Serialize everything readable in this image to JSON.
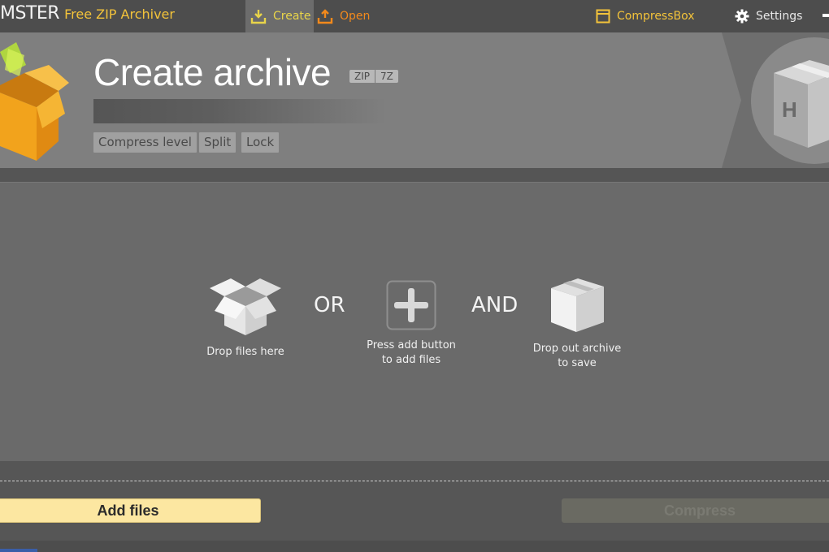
{
  "app": {
    "brand_name": "MSTER",
    "product_name": "Free ZIP Archiver"
  },
  "nav": {
    "create_label": "Create",
    "open_label": "Open",
    "compressbox_label": "CompressBox",
    "settings_label": "Settings"
  },
  "header": {
    "title": "Create archive",
    "formats": [
      "ZIP",
      "7Z"
    ],
    "options": {
      "compress_level": "Compress level",
      "split": "Split",
      "lock": "Lock"
    }
  },
  "droparea": {
    "step1": "Drop files here",
    "or": "OR",
    "step2_line1": "Press add button",
    "step2_line2": "to add files",
    "and": "AND",
    "step3_line1": "Drop out archive",
    "step3_line2": "to save"
  },
  "actions": {
    "add_files": "Add files",
    "compress": "Compress"
  },
  "colors": {
    "accent_yellow": "#f3c33a",
    "accent_orange": "#f2891c",
    "add_button": "#fce7a1"
  }
}
